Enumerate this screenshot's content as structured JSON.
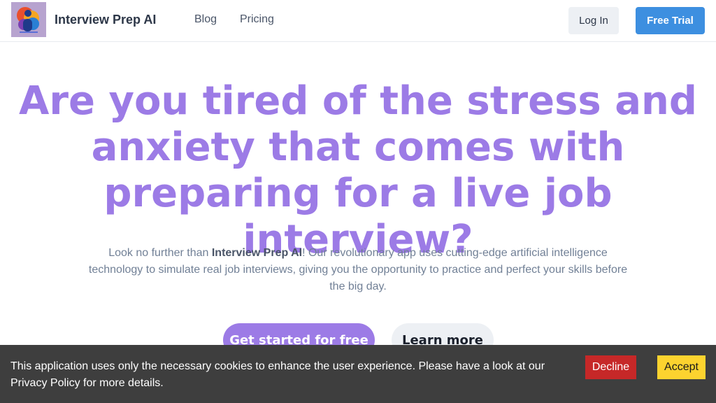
{
  "header": {
    "brand": "Interview Prep AI",
    "nav": [
      {
        "label": "Blog"
      },
      {
        "label": "Pricing"
      }
    ],
    "login_label": "Log In",
    "trial_label": "Free Trial"
  },
  "hero": {
    "title": "Are you tired of the stress and anxiety that comes with preparing for a live job interview?",
    "desc_before": "Look no further than ",
    "desc_brand": "Interview Prep AI",
    "desc_after": "! Our revolutionary app uses cutting-edge artificial intelligence technology to simulate real job interviews, giving you the opportunity to practice and perfect your skills before the big day.",
    "cta_primary": "Get started for free",
    "cta_secondary": "Learn more"
  },
  "cookie": {
    "text": "This application uses only the necessary cookies to enhance the user experience. Please have a look at our Privacy Policy for more details.",
    "decline_label": "Decline",
    "accept_label": "Accept"
  },
  "colors": {
    "accent": "#9c7be6",
    "primary_button": "#3d8fe0",
    "decline": "#c62828",
    "accept": "#fcd32f",
    "cookie_bg": "#3e3e3e"
  },
  "icons": {
    "logo": "brand-logo-icon"
  }
}
